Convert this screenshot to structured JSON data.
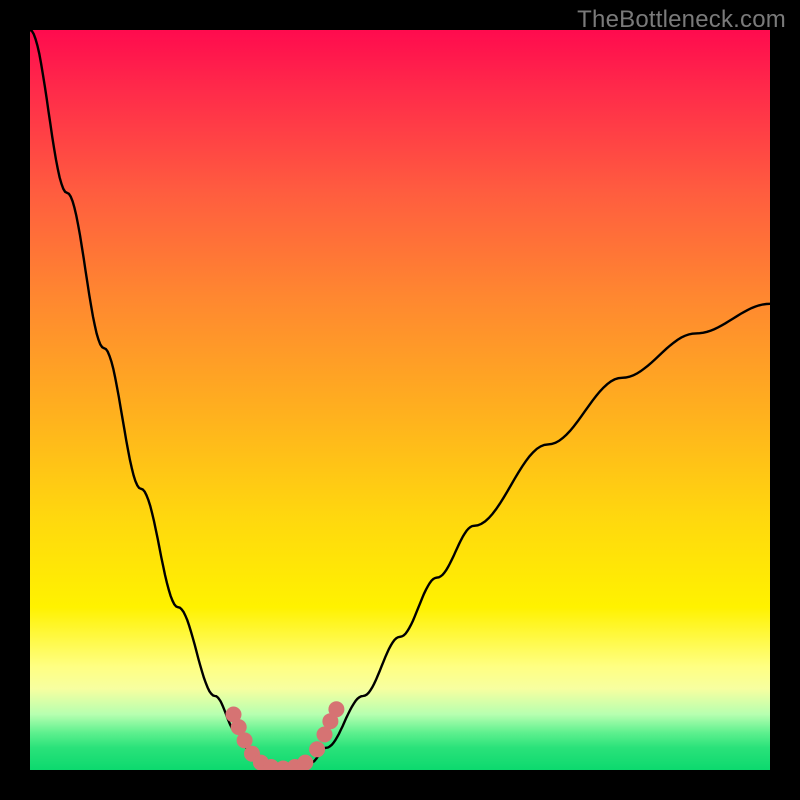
{
  "watermark": "TheBottleneck.com",
  "chart_data": {
    "type": "line",
    "title": "",
    "xlabel": "",
    "ylabel": "",
    "x": [
      0.0,
      0.05,
      0.1,
      0.15,
      0.2,
      0.25,
      0.28,
      0.3,
      0.32,
      0.34,
      0.36,
      0.38,
      0.4,
      0.45,
      0.5,
      0.55,
      0.6,
      0.7,
      0.8,
      0.9,
      1.0
    ],
    "y": [
      1.0,
      0.78,
      0.57,
      0.38,
      0.22,
      0.1,
      0.05,
      0.02,
      0.0,
      0.0,
      0.0,
      0.01,
      0.03,
      0.1,
      0.18,
      0.26,
      0.33,
      0.44,
      0.53,
      0.59,
      0.63
    ],
    "xlim": [
      0,
      1
    ],
    "ylim": [
      0,
      1
    ],
    "dots": [
      {
        "x": 0.275,
        "y": 0.075
      },
      {
        "x": 0.282,
        "y": 0.058
      },
      {
        "x": 0.29,
        "y": 0.04
      },
      {
        "x": 0.3,
        "y": 0.022
      },
      {
        "x": 0.312,
        "y": 0.01
      },
      {
        "x": 0.326,
        "y": 0.004
      },
      {
        "x": 0.342,
        "y": 0.002
      },
      {
        "x": 0.358,
        "y": 0.004
      },
      {
        "x": 0.372,
        "y": 0.01
      },
      {
        "x": 0.388,
        "y": 0.028
      },
      {
        "x": 0.398,
        "y": 0.048
      },
      {
        "x": 0.406,
        "y": 0.066
      },
      {
        "x": 0.414,
        "y": 0.082
      }
    ],
    "dot_color": "#d67373",
    "line_color": "#000000"
  }
}
